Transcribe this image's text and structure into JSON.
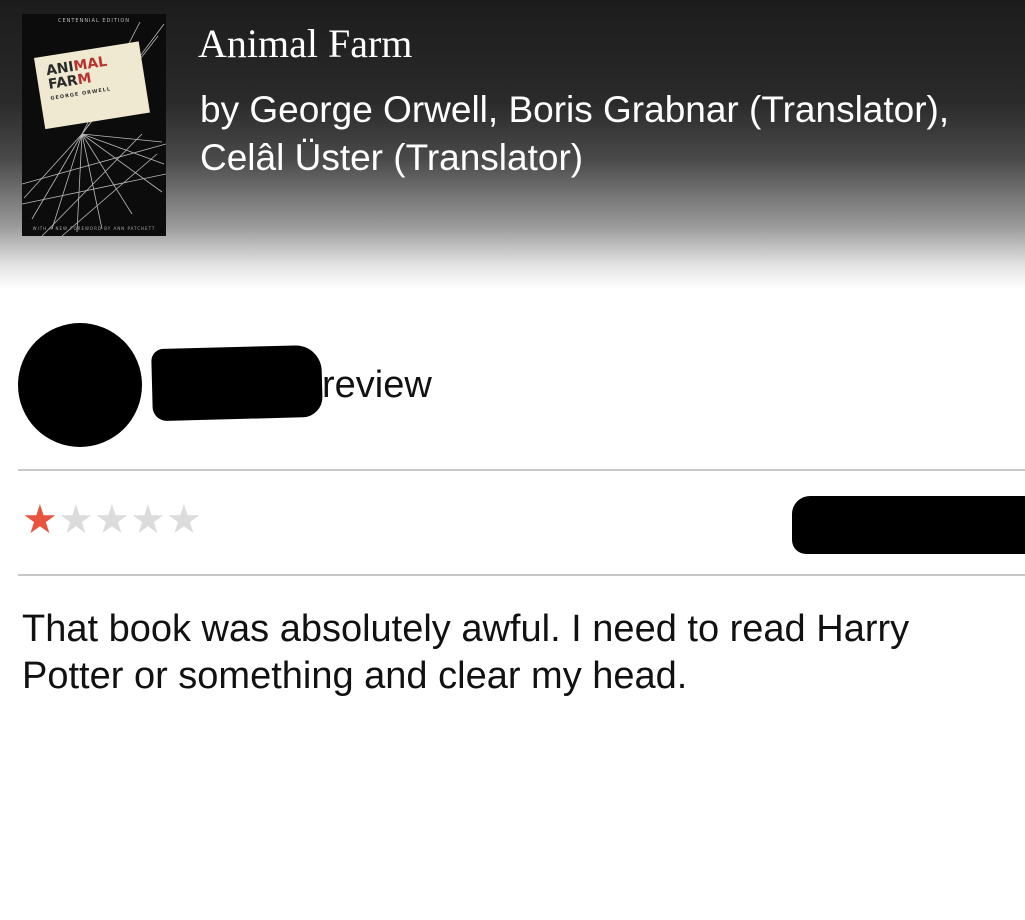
{
  "book": {
    "title": "Animal Farm",
    "authors": "by George Orwell, Boris Grabnar (Translator), Celâl Üster (Translator)",
    "cover": {
      "top_text": "CENTENNIAL EDITION",
      "title_line1_black": "ANI",
      "title_line1_red": "MAL",
      "title_line2_black": "FAR",
      "title_line2_red": "M",
      "author": "GEORGE ORWELL",
      "bottom_text": "WITH A NEW FOREWORD BY ANN PATCHETT"
    }
  },
  "review": {
    "label": "review",
    "rating": 1,
    "rating_max": 5,
    "star_filled_color": "#e8543e",
    "star_empty_color": "#dcdcdc",
    "body": "That book was absolutely awful. I need to read Harry Potter or something and clear my head."
  }
}
